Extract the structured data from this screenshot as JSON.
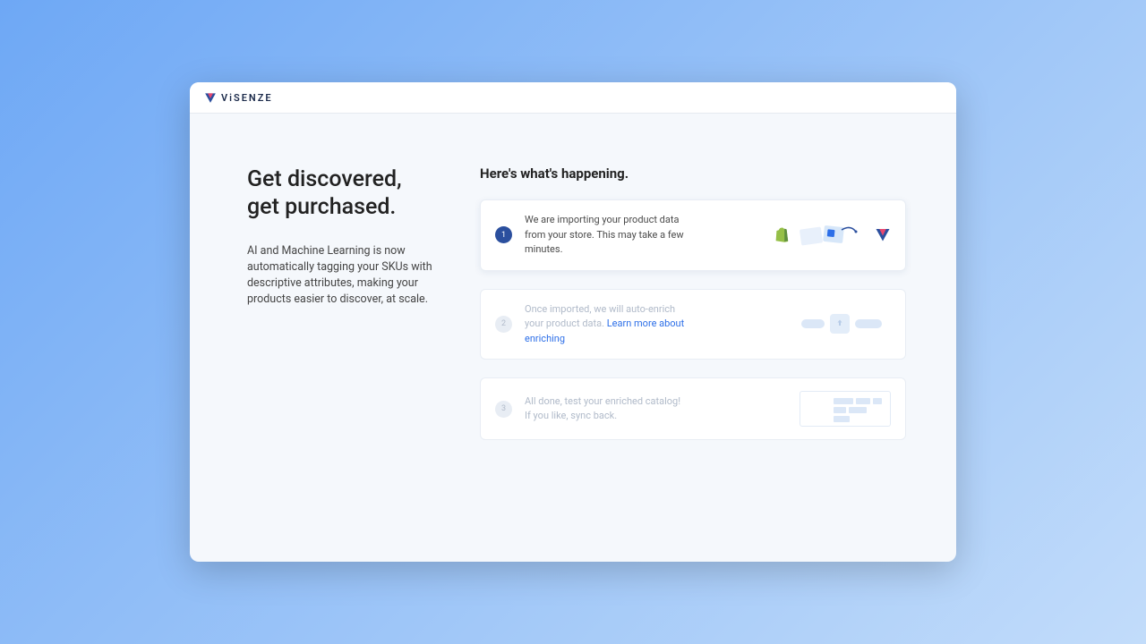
{
  "brand": {
    "name": "ViSENZE"
  },
  "left": {
    "headline_l1": "Get discovered,",
    "headline_l2": "get purchased.",
    "subtext": "AI and Machine Learning is now automatically tagging your SKUs with descriptive attributes, making your products easier to discover, at scale."
  },
  "right": {
    "heading": "Here's what's happening.",
    "steps": [
      {
        "num": "1",
        "text": "We are importing your product data from your store. This may take a few minutes."
      },
      {
        "num": "2",
        "text": "Once imported, we will auto-enrich your product data.",
        "link": "Learn more about enriching"
      },
      {
        "num": "3",
        "text_l1": "All done, test your enriched catalog!",
        "text_l2": "If you like, sync back."
      }
    ]
  }
}
